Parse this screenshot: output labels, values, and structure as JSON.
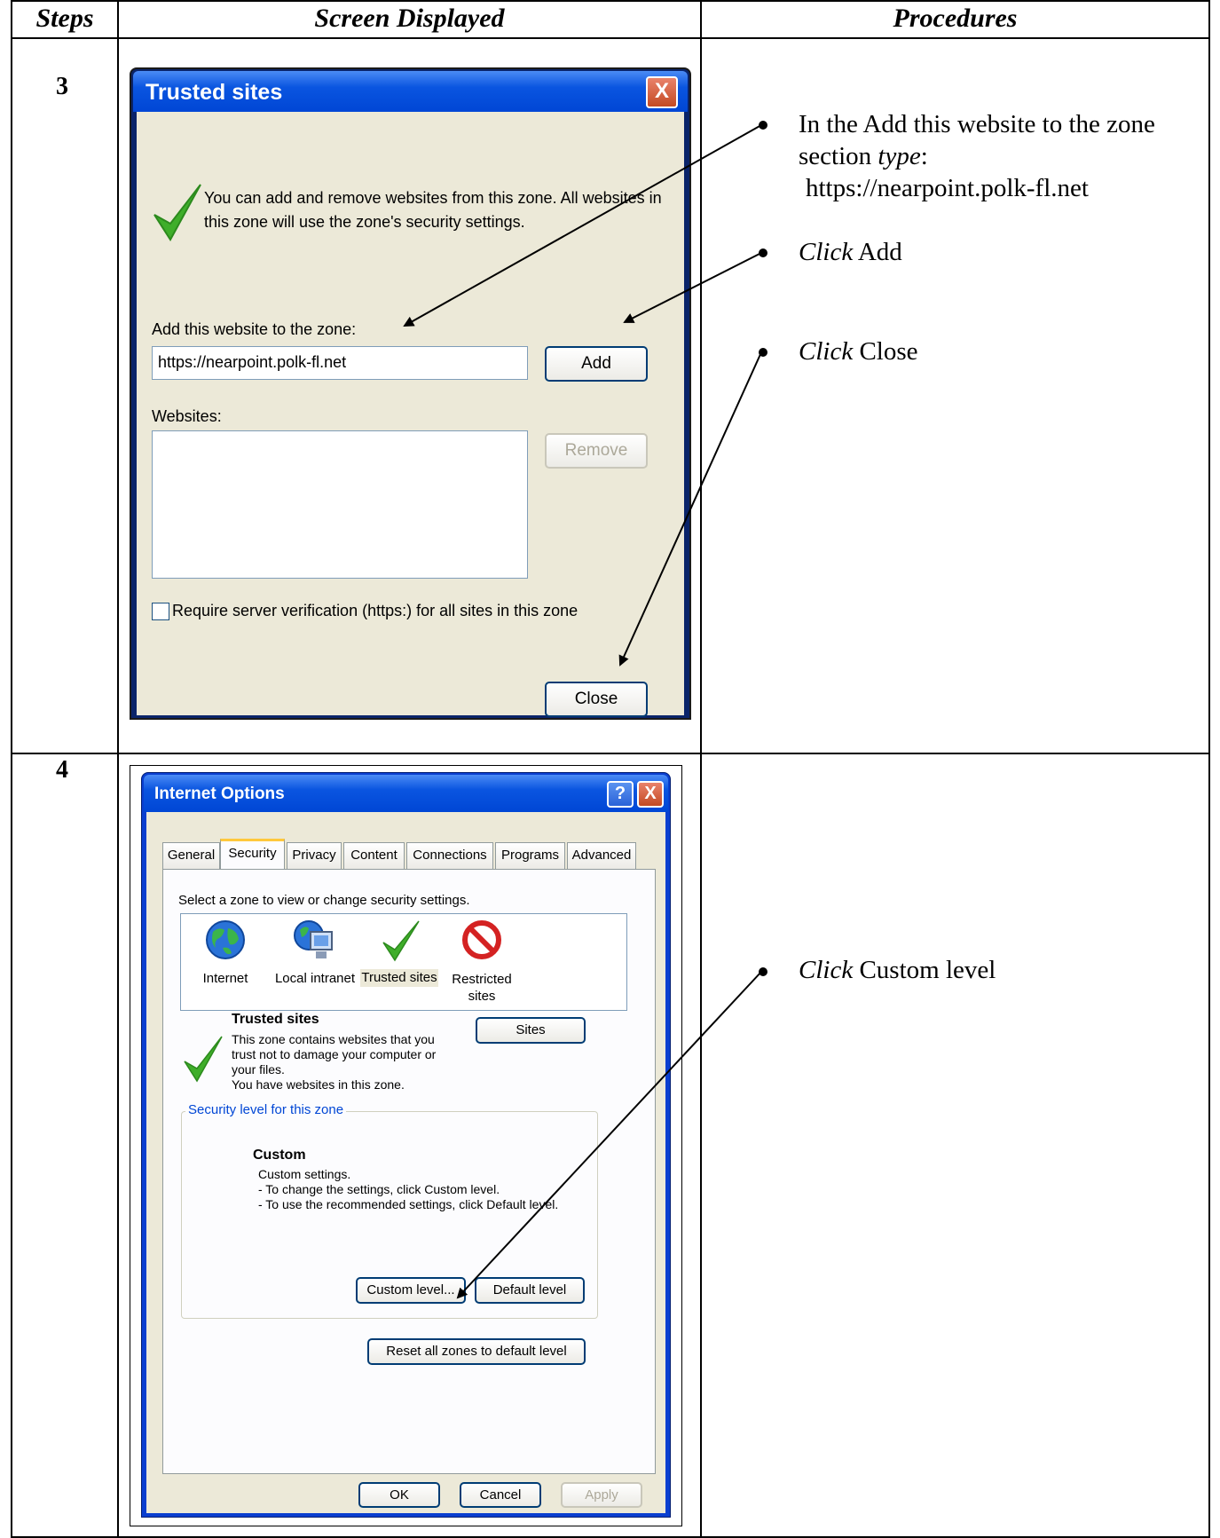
{
  "table": {
    "headers": {
      "steps": "Steps",
      "screen": "Screen Displayed",
      "procedures": "Procedures"
    },
    "rows": [
      {
        "step": "3",
        "procedures": [
          {
            "lines": [
              "In the Add this website to the zone",
              "section type:",
              "https://nearpoint.polk-fl.net"
            ]
          },
          {
            "lines": [
              "Click Add"
            ]
          },
          {
            "lines": [
              "Click Close"
            ]
          }
        ]
      },
      {
        "step": "4",
        "procedures": [
          {
            "lines": [
              "Click Custom level"
            ]
          }
        ]
      }
    ]
  },
  "trusted_dialog": {
    "title": "Trusted sites",
    "info": [
      "You can add and remove websites from this zone. All websites in",
      "this zone will use the zone's security settings."
    ],
    "add_label": "Add this website to the zone:",
    "url_value": "https://nearpoint.polk-fl.net",
    "add_button": "Add",
    "websites_label": "Websites:",
    "remove_button": "Remove",
    "checkbox_label": "Require server verification (https:) for all sites in this zone",
    "close_button": "Close",
    "close_x": "X"
  },
  "internet_options": {
    "title": "Internet Options",
    "help": "?",
    "close_x": "X",
    "tabs": [
      "General",
      "Security",
      "Privacy",
      "Content",
      "Connections",
      "Programs",
      "Advanced"
    ],
    "active_tab": "Security",
    "zone_prompt": "Select a zone to view or change security settings.",
    "zones": [
      {
        "label": "Internet",
        "icon": "globe-icon"
      },
      {
        "label": "Local intranet",
        "icon": "intranet-icon"
      },
      {
        "label": "Trusted sites",
        "icon": "checkmark-icon"
      },
      {
        "label": "Restricted sites",
        "label_line1": "Restricted",
        "label_line2": "sites",
        "icon": "restricted-icon"
      }
    ],
    "zone_title": "Trusted sites",
    "zone_desc": [
      "This zone contains websites that you",
      "trust not to damage your computer or",
      "your files.",
      "You have websites in this zone."
    ],
    "sites_button": "Sites",
    "security_group": "Security level for this zone",
    "level_title": "Custom",
    "level_desc": [
      "Custom settings.",
      "- To change the settings, click Custom level.",
      "- To use the recommended settings, click Default level."
    ],
    "custom_button": "Custom level...",
    "default_button": "Default level",
    "reset_button": "Reset all zones to default level",
    "ok_button": "OK",
    "cancel_button": "Cancel",
    "apply_button": "Apply"
  }
}
